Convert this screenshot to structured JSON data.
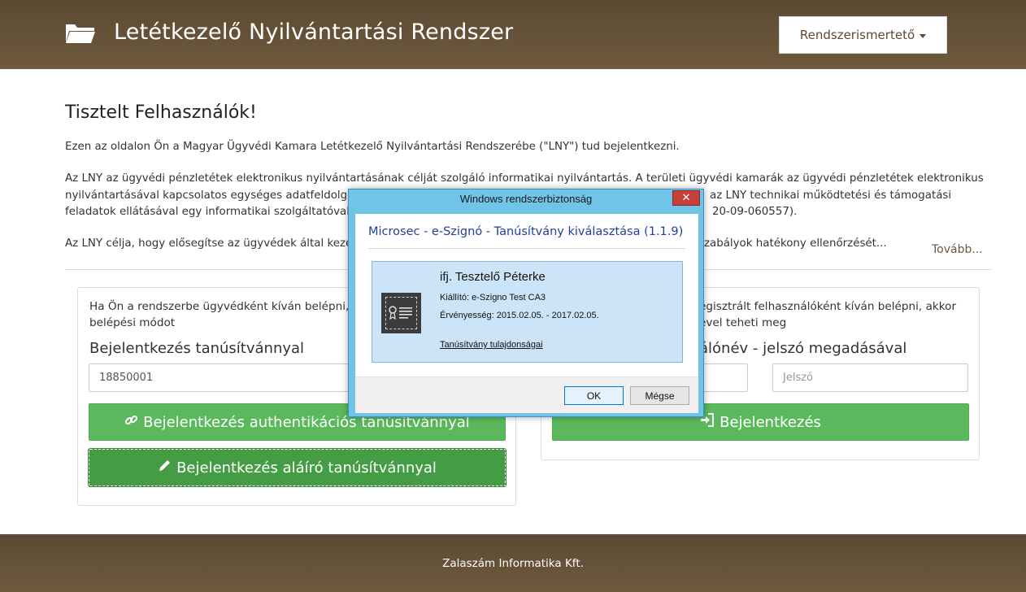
{
  "header": {
    "title": "Letétkezelő Nyilvántartási Rendszer",
    "menu_button": "Rendszerismertető"
  },
  "main": {
    "title": "Tisztelt Felhasználók!",
    "p1": "Ezen az oldalon Ön a Magyar Ügyvédi Kamara Letétkezelő Nyilvántartási Rendszerébe (\"LNY\") tud bejelentkezni.",
    "p2_line1": "Az LNY az ügyvédi pénzletétek elektronikus nyilvántartásának célját szolgáló informatikai nyilvántartás. A területi ügyvédi kamarák az ügyvédi pénzletétek elektronikus",
    "p2_line2_left": "nyilvántartásával kapcsolatos egységes adatfeldolgo",
    "p2_line2_right": "az LNY technikai működtetési és támogatási",
    "p2_line3_left": "feladatok ellátásával egy informatikai szolgáltatóval",
    "p2_line3_right": "20-09-060557).",
    "p3_left": "Az LNY célja, hogy elősegítse az ügyvédek által kezel",
    "p3_right": "szabályok hatékony ellenőrzését...",
    "more_link": "Tovább..."
  },
  "left_panel": {
    "intro_line1": "Ha Ön a rendszerbe ügyvédként kíván belépni, a",
    "intro_line2": "belépési módot",
    "heading": "Bejelentkezés tanúsítvánnyal",
    "cert_input_value": "18850001",
    "auth_button": "Bejelentkezés authentikációs tanúsítvánnyal",
    "sign_button": "Bejelentkezés aláíró tanúsítvánnyal"
  },
  "right_panel": {
    "intro_line1": "egisztrált felhasználóként kíván belépni, akkor",
    "intro_line2": "ével teheti meg",
    "heading": "álónév - jelszó megadásával",
    "password_placeholder": "Jelszó",
    "login_button": "Bejelentkezés"
  },
  "footer": {
    "text": "Zalaszám Informatika Kft."
  },
  "dialog": {
    "title": "Windows rendszerbiztonság",
    "heading": "Microsec - e-Szignó - Tanúsítvány kiválasztása (1.1.9)",
    "cert_name": "ifj. Tesztelő Péterke",
    "issuer": "Kiállító: e-Szigno Test CA3",
    "validity": "Érvényesség: 2015.02.05. - 2017.02.05.",
    "properties_link": "Tanúsítvány tulajdonságai",
    "ok": "OK",
    "cancel": "Mégse",
    "close_glyph": "✕"
  },
  "colors": {
    "header_bg": "#6e5a3d",
    "green": "#5cb85c",
    "green_dark": "#449d44",
    "dialog_frame": "#6fc4e8",
    "cert_selected": "#cce4f7"
  }
}
